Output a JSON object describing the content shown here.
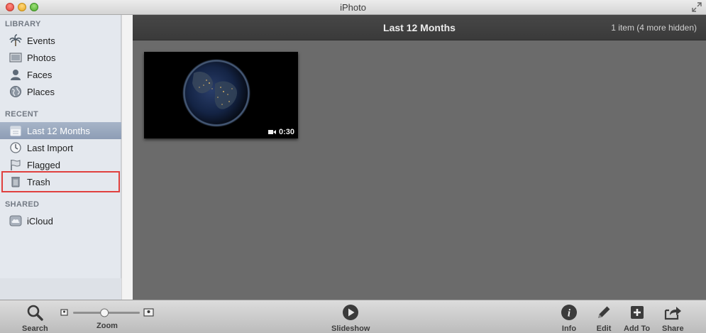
{
  "window": {
    "title": "iPhoto"
  },
  "sidebar": {
    "sections": [
      {
        "header": "LIBRARY",
        "items": [
          {
            "label": "Events",
            "icon": "palm-tree-icon"
          },
          {
            "label": "Photos",
            "icon": "photo-frame-icon"
          },
          {
            "label": "Faces",
            "icon": "person-icon"
          },
          {
            "label": "Places",
            "icon": "globe-icon"
          }
        ]
      },
      {
        "header": "RECENT",
        "items": [
          {
            "label": "Last 12 Months",
            "icon": "calendar-icon",
            "selected": true
          },
          {
            "label": "Last Import",
            "icon": "clock-icon"
          },
          {
            "label": "Flagged",
            "icon": "flag-icon"
          },
          {
            "label": "Trash",
            "icon": "trash-icon",
            "highlighted": true
          }
        ]
      },
      {
        "header": "SHARED",
        "items": [
          {
            "label": "iCloud",
            "icon": "cloud-icon"
          }
        ]
      }
    ]
  },
  "main": {
    "title": "Last 12 Months",
    "count": "1 item (4 more hidden)",
    "items": [
      {
        "type": "video",
        "duration": "0:30",
        "icon": "video-camera-icon"
      }
    ]
  },
  "toolbar": {
    "search": "Search",
    "zoom": "Zoom",
    "zoom_level": 0.47,
    "slideshow": "Slideshow",
    "info": "Info",
    "edit": "Edit",
    "add_to": "Add To",
    "share": "Share"
  },
  "colors": {
    "selection": "#8d9db5",
    "highlight_box": "#e0403e",
    "main_bg": "#6b6b6b",
    "header_bg": "#3f3f3f"
  }
}
